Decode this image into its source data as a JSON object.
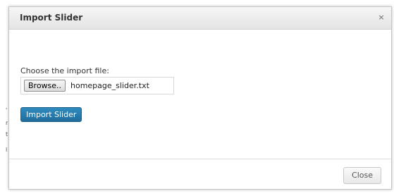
{
  "dialog": {
    "title": "Import Slider",
    "close_icon_glyph": "×",
    "choose_label": "Choose the import file:",
    "file_input": {
      "browse_label": "Browse..",
      "file_name": "homepage_slider.txt"
    },
    "import_button_label": "Import Slider",
    "close_button_label": "Close"
  },
  "colors": {
    "primary_button": "#2579a9",
    "titlebar": "#ececec"
  },
  "icons": {
    "titlebar_close": "close-icon"
  }
}
